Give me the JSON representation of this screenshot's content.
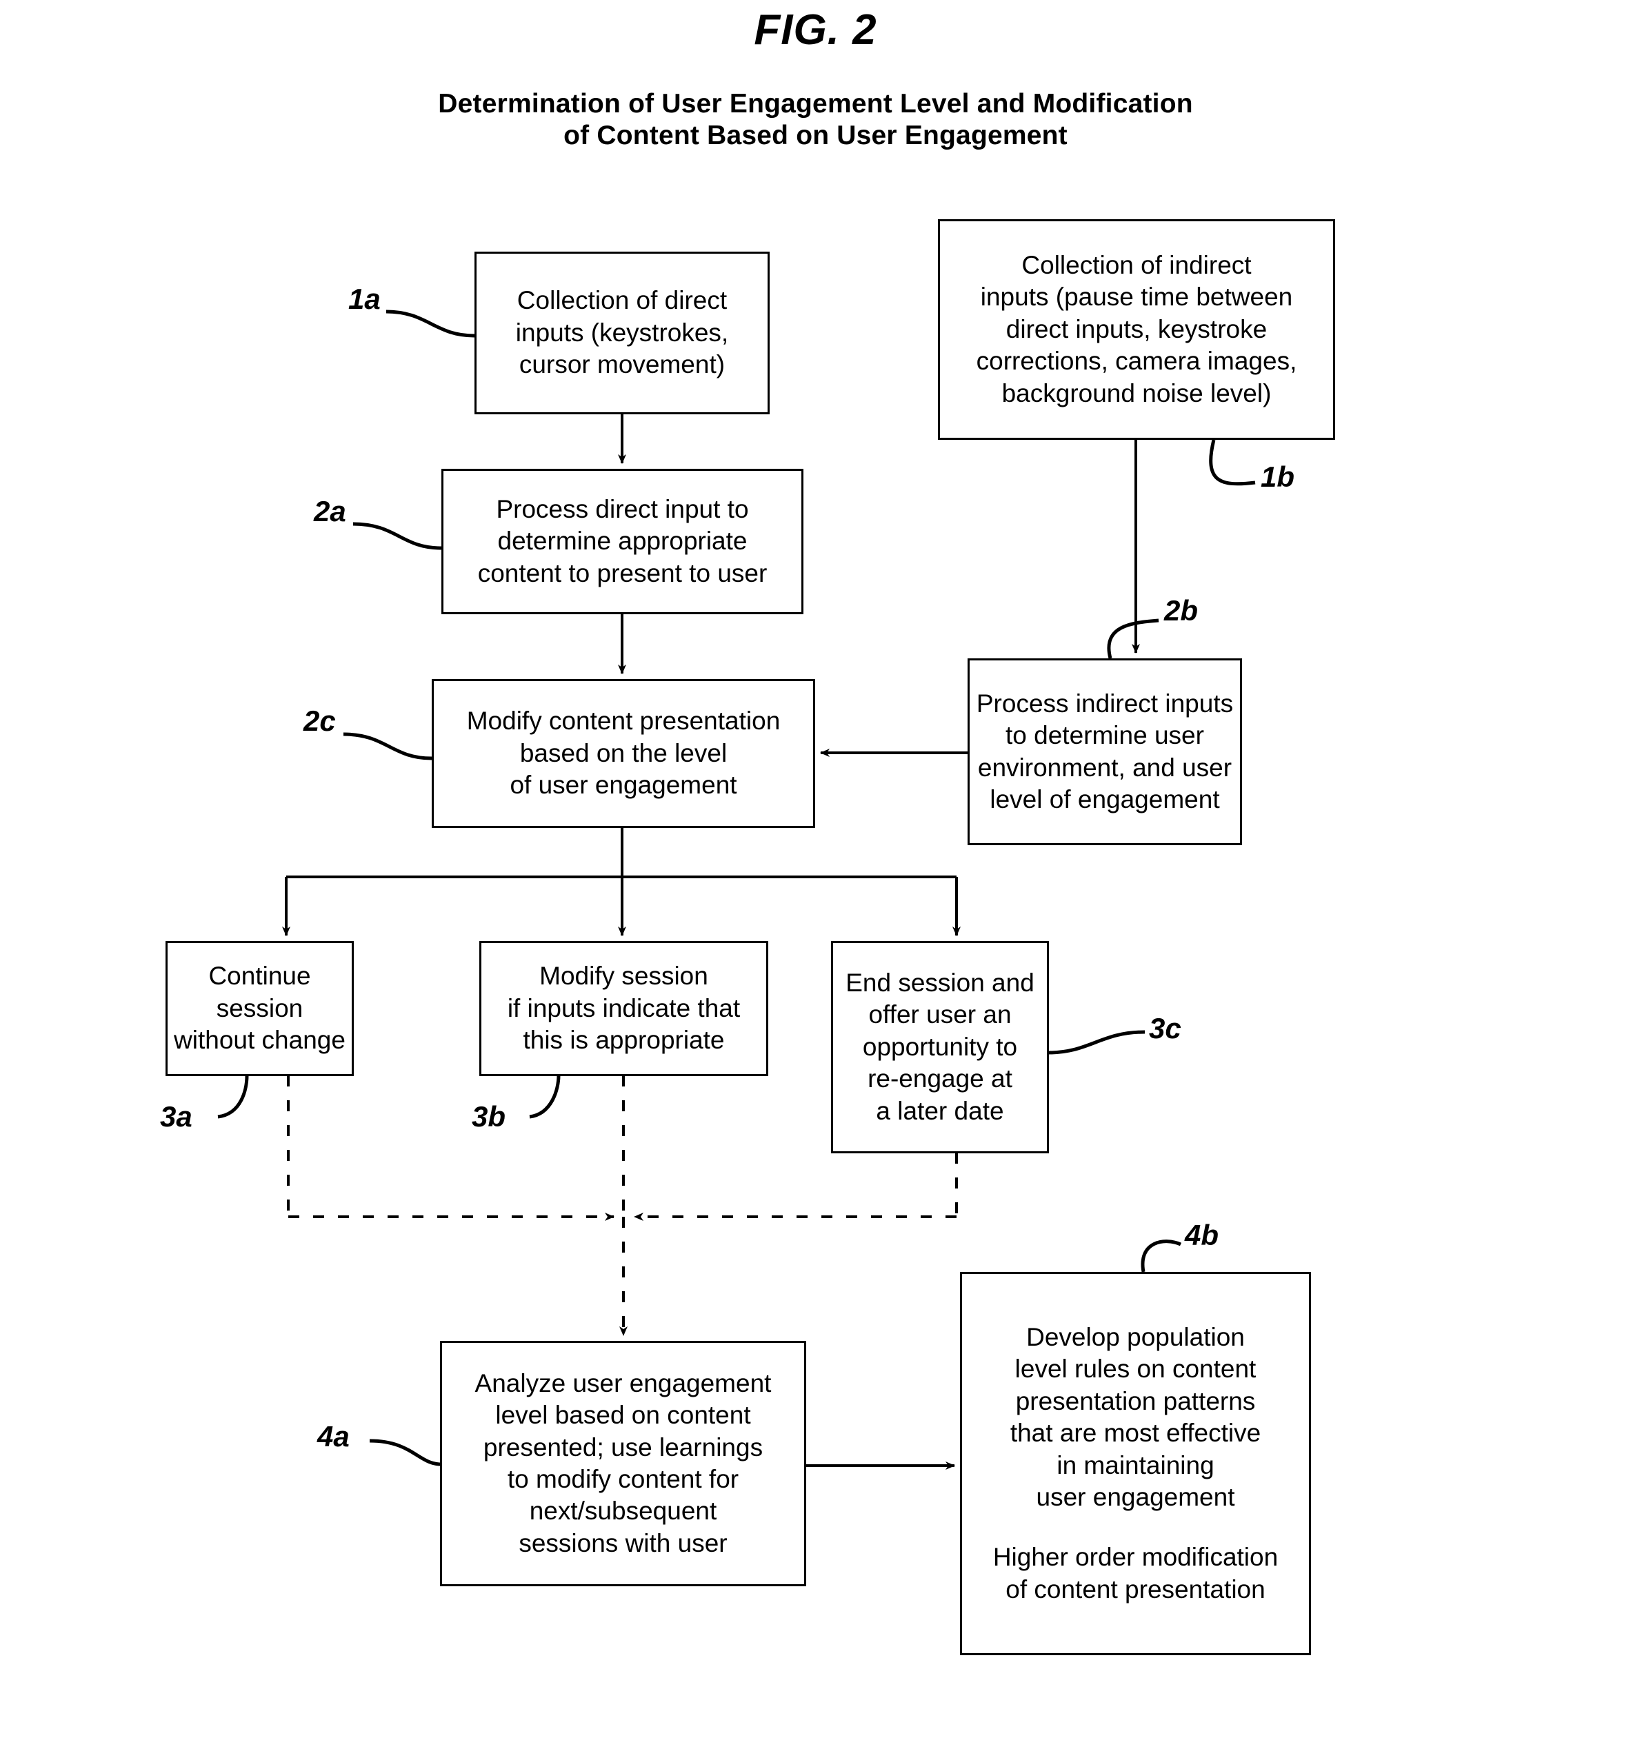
{
  "figure": {
    "label": "FIG. 2",
    "title_line1": "Determination of User Engagement Level and Modification",
    "title_line2": "of Content Based on User Engagement"
  },
  "boxes": {
    "b1a": {
      "ref": "1a",
      "text": "Collection of direct\ninputs (keystrokes,\ncursor movement)"
    },
    "b1b": {
      "ref": "1b",
      "text": "Collection of indirect\ninputs (pause time between\ndirect inputs, keystroke\ncorrections, camera images,\nbackground noise level)"
    },
    "b2a": {
      "ref": "2a",
      "text": "Process direct input to\ndetermine appropriate\ncontent to present to user"
    },
    "b2b": {
      "ref": "2b",
      "text": "Process indirect inputs\nto determine user\nenvironment, and user\nlevel of engagement"
    },
    "b2c": {
      "ref": "2c",
      "text": "Modify content presentation\nbased on the level\nof user engagement"
    },
    "b3a": {
      "ref": "3a",
      "text": "Continue session\nwithout change"
    },
    "b3b": {
      "ref": "3b",
      "text": "Modify session\nif inputs indicate that\nthis is appropriate"
    },
    "b3c": {
      "ref": "3c",
      "text": "End session and\noffer user an\nopportunity to\nre-engage at\na later date"
    },
    "b4a": {
      "ref": "4a",
      "text": "Analyze user engagement\nlevel based on content\npresented; use learnings\nto modify content for\nnext/subsequent\nsessions with user"
    },
    "b4b": {
      "ref": "4b",
      "text_part1": "Develop population\nlevel rules on content\npresentation patterns\nthat are most effective\nin maintaining\nuser engagement",
      "text_part2": "Higher order modification\nof content presentation"
    }
  },
  "colors": {
    "stroke": "#000000",
    "background": "#ffffff"
  }
}
